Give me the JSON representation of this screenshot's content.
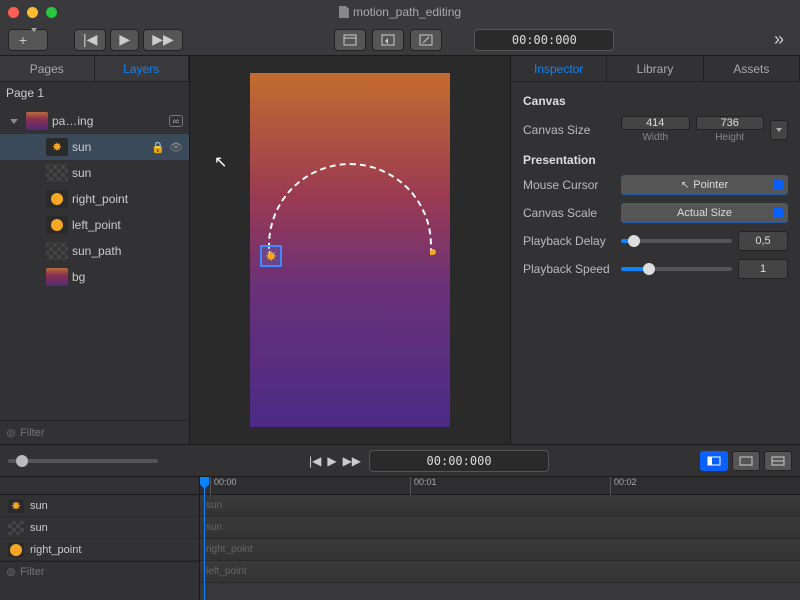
{
  "titlebar": {
    "document_name": "motion_path_editing"
  },
  "toolbar": {
    "add_label": "+",
    "timecode": "00:00:000"
  },
  "left_panel": {
    "tabs": {
      "pages": "Pages",
      "layers": "Layers"
    },
    "page_header": "Page 1",
    "layers": [
      {
        "name": "pa…ing",
        "thumb": "grad",
        "linked": true
      },
      {
        "name": "sun",
        "thumb": "sun",
        "locked": true,
        "visible": true
      },
      {
        "name": "sun",
        "thumb": "empty"
      },
      {
        "name": "right_point",
        "thumb": "dot"
      },
      {
        "name": "left_point",
        "thumb": "dot"
      },
      {
        "name": "sun_path",
        "thumb": "empty"
      },
      {
        "name": "bg",
        "thumb": "grad"
      }
    ],
    "filter_placeholder": "Filter"
  },
  "right_panel": {
    "tabs": {
      "inspector": "Inspector",
      "library": "Library",
      "assets": "Assets"
    },
    "canvas_section": "Canvas",
    "canvas_size_label": "Canvas Size",
    "width_value": "414",
    "width_label": "Width",
    "height_value": "736",
    "height_label": "Height",
    "presentation_section": "Presentation",
    "mouse_cursor_label": "Mouse Cursor",
    "mouse_cursor_value": "Pointer",
    "canvas_scale_label": "Canvas Scale",
    "canvas_scale_value": "Actual Size",
    "playback_delay_label": "Playback Delay",
    "playback_delay_value": "0,5",
    "playback_speed_label": "Playback Speed",
    "playback_speed_value": "1"
  },
  "bottom": {
    "timecode": "00:00:000"
  },
  "timeline": {
    "ticks": [
      "00:00",
      "00:01",
      "00:02"
    ],
    "tracks": [
      "sun",
      "sun",
      "right_point",
      "left_point"
    ],
    "left_layers": [
      {
        "name": "sun",
        "thumb": "sun"
      },
      {
        "name": "sun",
        "thumb": "empty"
      },
      {
        "name": "right_point",
        "thumb": "dot"
      }
    ],
    "filter_placeholder": "Filter"
  },
  "link_badge": "⌕"
}
